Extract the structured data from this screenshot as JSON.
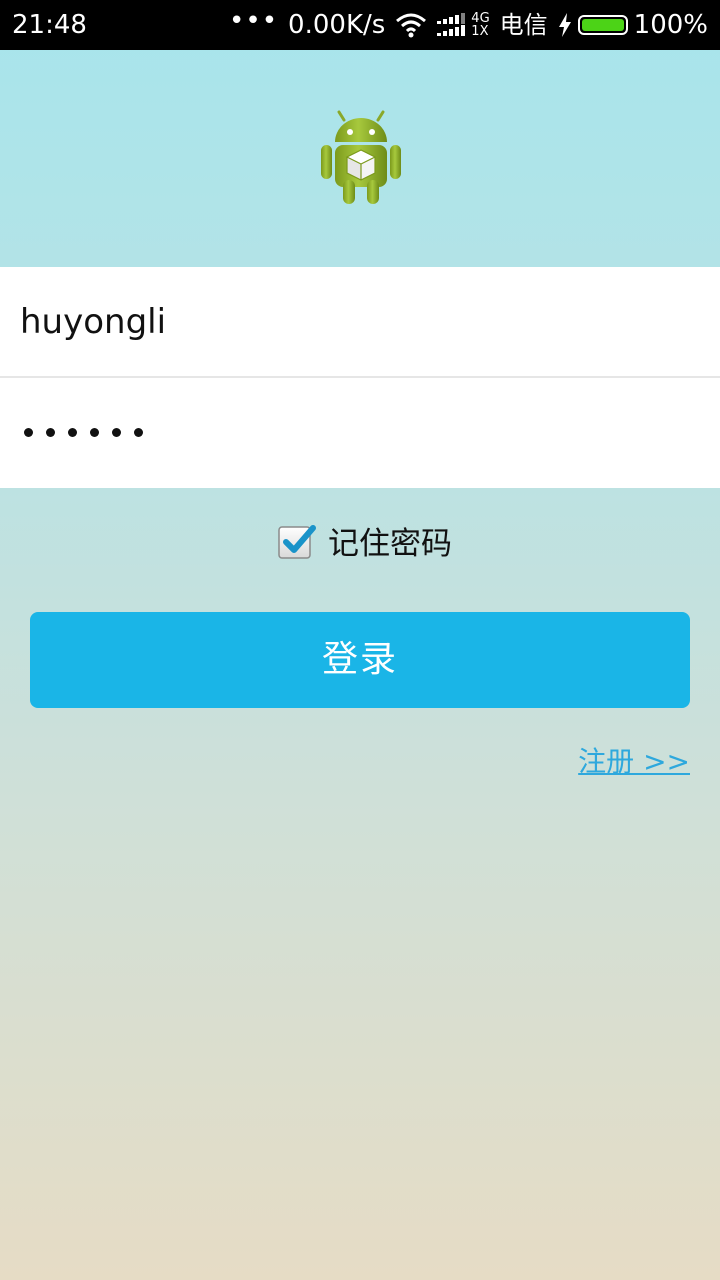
{
  "status_bar": {
    "time": "21:48",
    "dots": "•••",
    "net_speed": "0.00K/s",
    "net_type_top": "4G",
    "net_type_bottom": "1X",
    "carrier": "电信",
    "battery_percent": "100%",
    "battery_level": 1.0
  },
  "app_icon": "android-icon",
  "login": {
    "username_value": "huyongli",
    "password_mask_count": 6,
    "remember_label": "记住密码",
    "remember_checked": true,
    "login_button_label": "登录",
    "register_link_label": "注册 >>"
  },
  "colors": {
    "accent": "#1ab5e7",
    "link": "#2ea8dd",
    "battery": "#4cd317"
  }
}
